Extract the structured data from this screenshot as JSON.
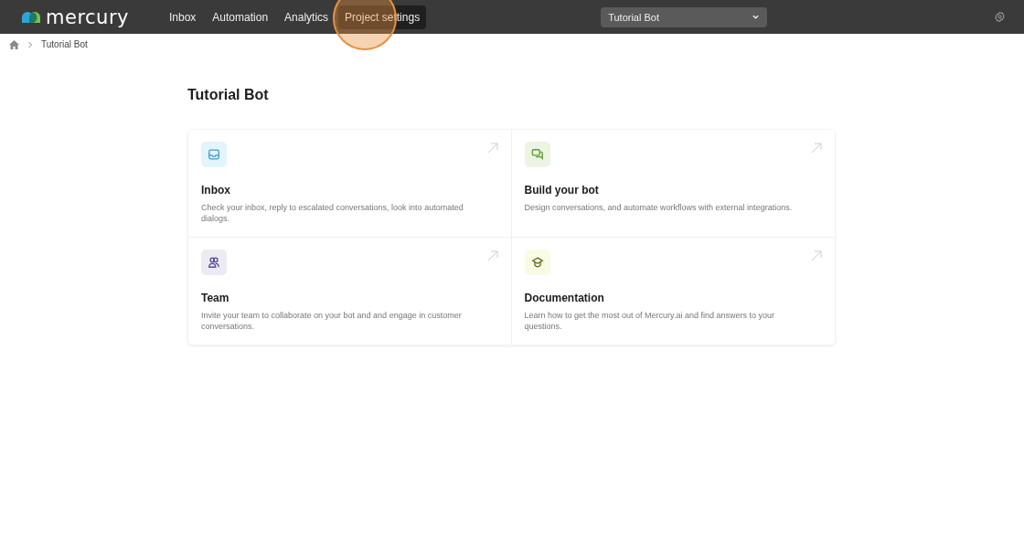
{
  "header": {
    "logo": "mercury",
    "nav": [
      {
        "label": "Inbox",
        "selected": false
      },
      {
        "label": "Automation",
        "selected": false
      },
      {
        "label": "Analytics",
        "selected": false
      },
      {
        "label": "Project settings",
        "selected": true
      }
    ],
    "project_select": {
      "value": "Tutorial Bot"
    }
  },
  "breadcrumb": [
    "Tutorial Bot"
  ],
  "page_title": "Tutorial Bot",
  "cards": [
    {
      "kind": "inbox",
      "title": "Inbox",
      "description": "Check your inbox, reply to escalated conversations, look into automated dialogs."
    },
    {
      "kind": "build",
      "title": "Build your bot",
      "description": "Design conversations, and automate workflows with external integrations."
    },
    {
      "kind": "team",
      "title": "Team",
      "description": "Invite your team to collaborate on your bot and and engage in customer conversations."
    },
    {
      "kind": "docs",
      "title": "Documentation",
      "description": "Learn how to get the most out of Mercury.ai and find answers to your questions."
    }
  ]
}
